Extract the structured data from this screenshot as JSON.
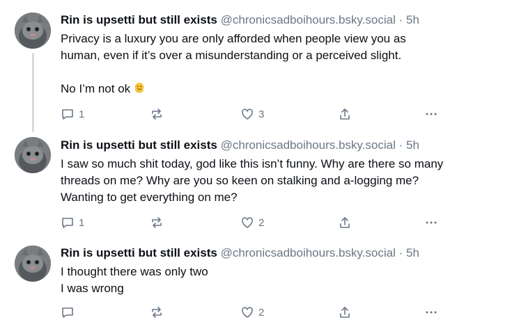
{
  "posts": [
    {
      "author": "Rin is upsetti but still exists",
      "handle": "@chronicsadboihours.bsky.social",
      "separator": "·",
      "time": "5h",
      "line1": "Privacy is a luxury you are only afforded when people view you as",
      "line2": "human, even if it’s over a misunderstanding or a perceived slight.",
      "line3": "No I’m not ok",
      "reply_count": "1",
      "like_count": "3"
    },
    {
      "author": "Rin is upsetti but still exists",
      "handle": "@chronicsadboihours.bsky.social",
      "separator": "·",
      "time": "5h",
      "line1": "I saw so much shit today, god like this isn’t funny. Why are there so many",
      "line2": "threads on me? Why are you so keen on stalking and a-logging me?",
      "line3": "Wanting to get everything on me?",
      "reply_count": "1",
      "like_count": "2"
    },
    {
      "author": "Rin is upsetti but still exists",
      "handle": "@chronicsadboihours.bsky.social",
      "separator": "·",
      "time": "5h",
      "line1": "I thought there was only two",
      "line2": "I was wrong",
      "reply_count": "",
      "like_count": "2"
    }
  ],
  "icons": {
    "reply": "reply-icon",
    "repost": "repost-icon",
    "like": "heart-icon",
    "share": "share-icon",
    "more": "more-icon",
    "emoji": "melting-face-emoji"
  },
  "colors": {
    "muted": "#6b7785",
    "thread_line": "#d4dbe2",
    "text": "#0b0f14"
  }
}
